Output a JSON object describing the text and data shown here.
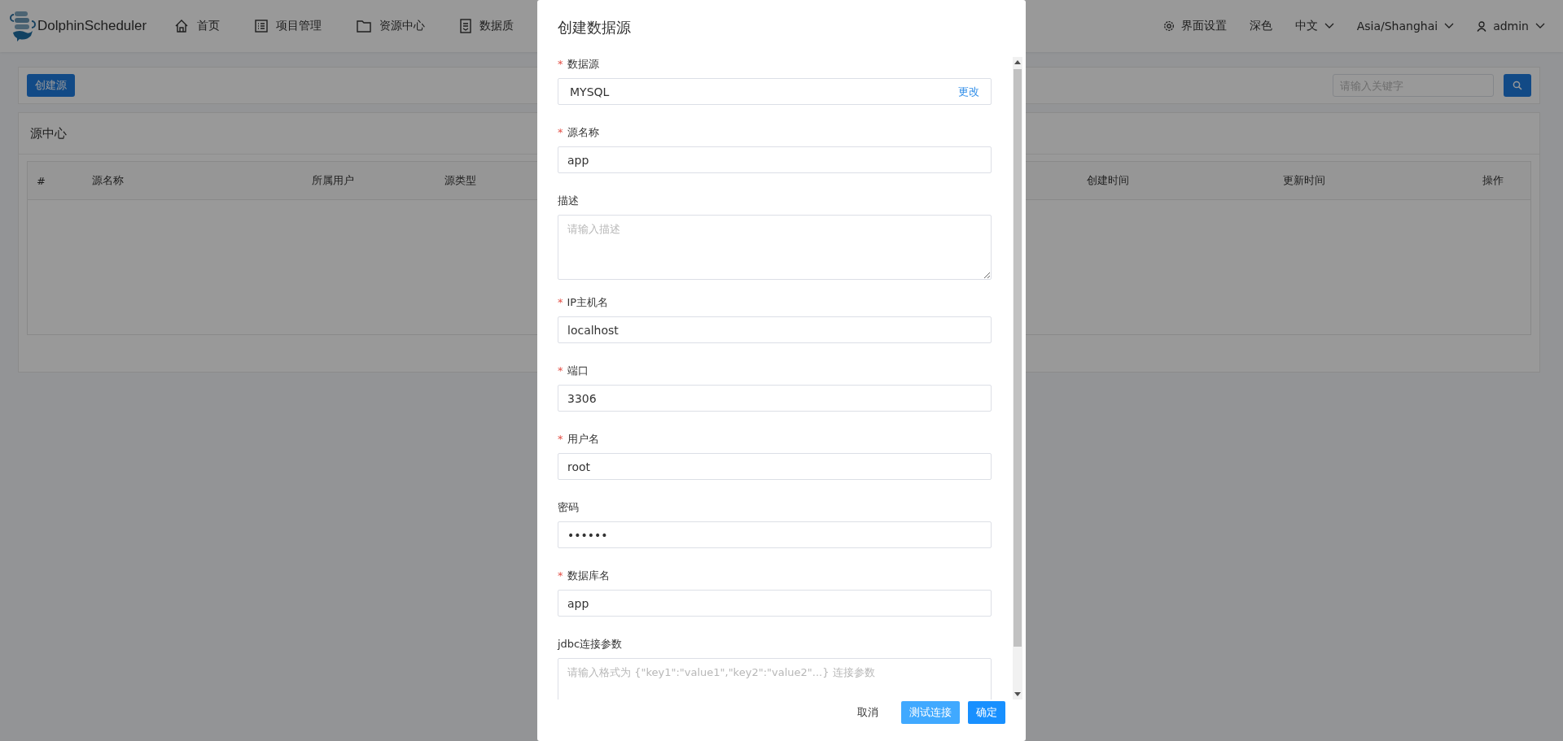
{
  "header": {
    "brand": "DolphinScheduler",
    "nav": [
      {
        "label": "首页"
      },
      {
        "label": "项目管理"
      },
      {
        "label": "资源中心"
      },
      {
        "label": "数据质"
      }
    ],
    "settings": "界面设置",
    "theme": "深色",
    "language": "中文",
    "timezone": "Asia/Shanghai",
    "user": "admin"
  },
  "toolbar": {
    "create_button": "创建源",
    "search": {
      "placeholder": "请输入关键字"
    }
  },
  "panel": {
    "title": "源中心",
    "table": {
      "columns": [
        "#",
        "源名称",
        "所属用户",
        "源类型",
        "",
        "创建时间",
        "更新时间",
        "操作"
      ]
    }
  },
  "dialog": {
    "title": "创建数据源",
    "fields": [
      {
        "kind": "select",
        "marker": "*",
        "label": "数据源",
        "value": "MYSQL",
        "action": "更改"
      },
      {
        "kind": "text",
        "marker": "*",
        "label": "源名称",
        "value": "app"
      },
      {
        "kind": "textarea",
        "label": "描述",
        "placeholder": "请输入描述"
      },
      {
        "kind": "text",
        "marker": "*",
        "label": "IP主机名",
        "value": "localhost"
      },
      {
        "kind": "text",
        "marker": "*",
        "label": "端口",
        "value": "3306"
      },
      {
        "kind": "text",
        "marker": "*",
        "label": "用户名",
        "value": "root"
      },
      {
        "kind": "text",
        "label": "密码",
        "value": "••••••"
      },
      {
        "kind": "text",
        "marker": "*",
        "label": "数据库名",
        "value": "app"
      },
      {
        "kind": "textarea",
        "label": "jdbc连接参数",
        "placeholder": "请输入格式为 {\"key1\":\"value1\",\"key2\":\"value2\"...} 连接参数"
      }
    ],
    "buttons": [
      {
        "label": "取消",
        "kind": "plain"
      },
      {
        "label": "测试连接",
        "kind": "light"
      },
      {
        "label": "确定",
        "kind": "primary"
      }
    ]
  }
}
